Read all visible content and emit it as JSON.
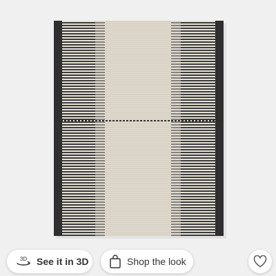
{
  "product": {
    "image_icon": "rug-image",
    "colors": {
      "background": "#f0f0f0",
      "rug_cream": "#ddd8cb",
      "rug_charcoal": "#3c3c3c"
    }
  },
  "actions": {
    "view_3d": {
      "icon": "3d-rotate-icon",
      "label": "See it in 3D"
    },
    "shop_look": {
      "icon": "shopping-bag-icon",
      "label": "Shop the look"
    },
    "favorite": {
      "icon": "heart-icon"
    }
  }
}
